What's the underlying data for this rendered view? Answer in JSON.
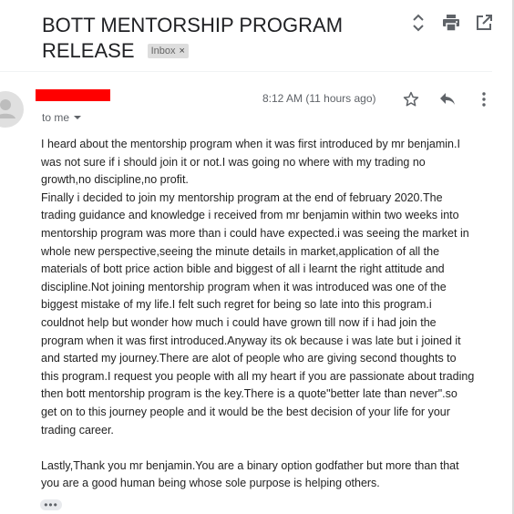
{
  "email": {
    "subject": "BOTT MENTORSHIP PROGRAM RELEASE",
    "label_chip": "Inbox",
    "label_chip_close": "×",
    "timestamp": "8:12 AM (11 hours ago)",
    "recipient_line": "to me",
    "body": "I heard about the mentorship program when it was first introduced by mr benjamin.I\nwas not sure if i should join it or not.I was going no where with my trading no\ngrowth,no discipline,no profit.\nFinally i decided to join my mentorship program at the end of february 2020.The\ntrading guidance and knowledge i received from mr benjamin within two weeks into\nmentorship program was more than i could have expected.i was seeing the market in\nwhole new perspective,seeing the minute details in market,application of all the\nmaterials of bott price action bible and biggest of all i learnt the right attitude and\ndiscipline.Not joining mentorship program when it was introduced was one of the\nbiggest mistake of my life.I felt such regret for being so late into this program.i\ncouldnot help but wonder how much i could have grown till now if i had join the\nprogram when it was first introduced.Anyway its ok because i was late but i joined it\nand started my journey.There are alot of people who are giving second thoughts to\nthis program.I request you people with all my heart if you are passionate about trading\nthen bott mentorship program is the key.There is a quote\"better late than never\".so\nget on to this journey people and it would be the best decision of your life for your\ntrading career.\n\nLastly,Thank you mr benjamin.You are a binary option godfather but more than that\nyou are a good human being whose sole purpose is helping others.",
    "more_indicator": "•••"
  },
  "icons": {
    "expand": "unfold-icon",
    "print": "print-icon",
    "open_new_window": "open-in-new-window-icon",
    "star": "star-icon",
    "reply": "reply-icon",
    "more": "more-vert-icon",
    "avatar": "person-avatar-icon",
    "dropdown": "chevron-down-icon"
  },
  "colors": {
    "redaction": "#ff0000",
    "chip_bg": "#dddddd",
    "icon": "#5f6368",
    "text": "#222222"
  }
}
